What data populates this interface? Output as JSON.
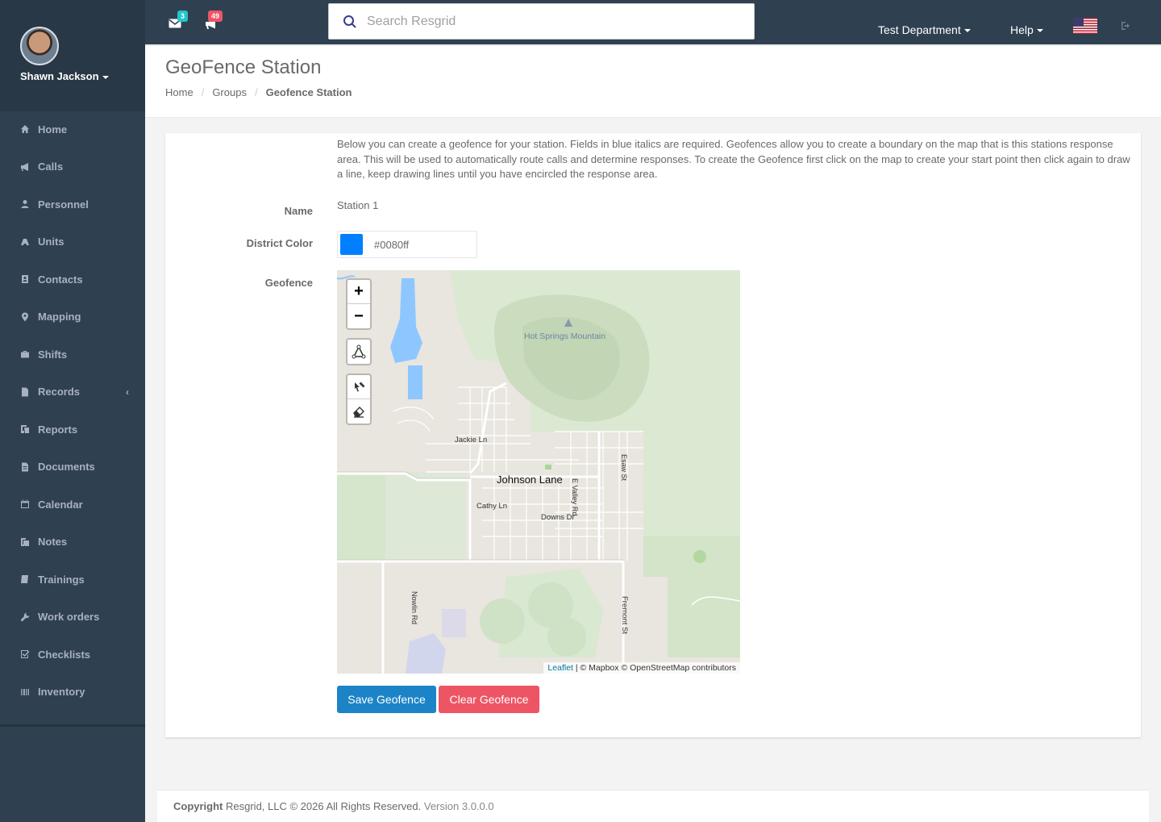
{
  "user": {
    "name": "Shawn Jackson"
  },
  "sidebar": {
    "items": [
      {
        "label": "Home",
        "icon": "home-icon"
      },
      {
        "label": "Calls",
        "icon": "bullhorn-icon"
      },
      {
        "label": "Personnel",
        "icon": "user-icon"
      },
      {
        "label": "Units",
        "icon": "truck-icon"
      },
      {
        "label": "Contacts",
        "icon": "address-book-icon"
      },
      {
        "label": "Mapping",
        "icon": "map-marker-icon"
      },
      {
        "label": "Shifts",
        "icon": "briefcase-icon"
      },
      {
        "label": "Records",
        "icon": "file-icon",
        "has_submenu": true
      },
      {
        "label": "Reports",
        "icon": "report-icon"
      },
      {
        "label": "Documents",
        "icon": "document-icon"
      },
      {
        "label": "Calendar",
        "icon": "calendar-icon"
      },
      {
        "label": "Notes",
        "icon": "notes-icon"
      },
      {
        "label": "Trainings",
        "icon": "graduation-icon"
      },
      {
        "label": "Work orders",
        "icon": "wrench-icon"
      },
      {
        "label": "Checklists",
        "icon": "check-square-icon"
      },
      {
        "label": "Inventory",
        "icon": "barcode-icon"
      }
    ]
  },
  "topbar": {
    "messages_count": "3",
    "calls_count": "49",
    "search_placeholder": "Search Resgrid",
    "department": "Test Department",
    "help": "Help"
  },
  "heading": {
    "title": "GeoFence Station",
    "breadcrumb": [
      "Home",
      "Groups",
      "Geofence Station"
    ]
  },
  "form": {
    "intro": "Below you can create a geofence for your station. Fields in blue italics are required. Geofences allow you to create a boundary on the map that is this stations response area. This will be used to automatically route calls and determine responses. To create the Geofence first click on the map to create your start point then click again to draw a line, keep drawing lines until you have encircled the response area.",
    "name_label": "Name",
    "name_value": "Station 1",
    "color_label": "District Color",
    "color_value": "#0080ff",
    "geofence_label": "Geofence"
  },
  "map": {
    "labels": {
      "mountain": "Hot Springs Mountain",
      "jackie": "Jackie Ln",
      "johnson": "Johnson Lane",
      "cathy": "Cathy Ln",
      "downs": "Downs Dr",
      "valley": "E Valley Rd",
      "esaw": "Esaw St",
      "nowlin": "Nowlin Rd",
      "fremont": "Fremont St"
    },
    "zoom_in": "+",
    "zoom_out": "−",
    "attribution_link": "Leaflet",
    "attribution_text": " | © Mapbox © OpenStreetMap contributors"
  },
  "buttons": {
    "save": "Save Geofence",
    "clear": "Clear Geofence"
  },
  "footer": {
    "copyright_bold": "Copyright",
    "copyright_text": " Resgrid, LLC © 2026 All Rights Reserved.",
    "version": " Version 3.0.0.0"
  },
  "colors": {
    "sidebar": "#2f4050",
    "primary": "#1c84c6",
    "danger": "#ed5565",
    "badge_info": "#23c6c8"
  }
}
